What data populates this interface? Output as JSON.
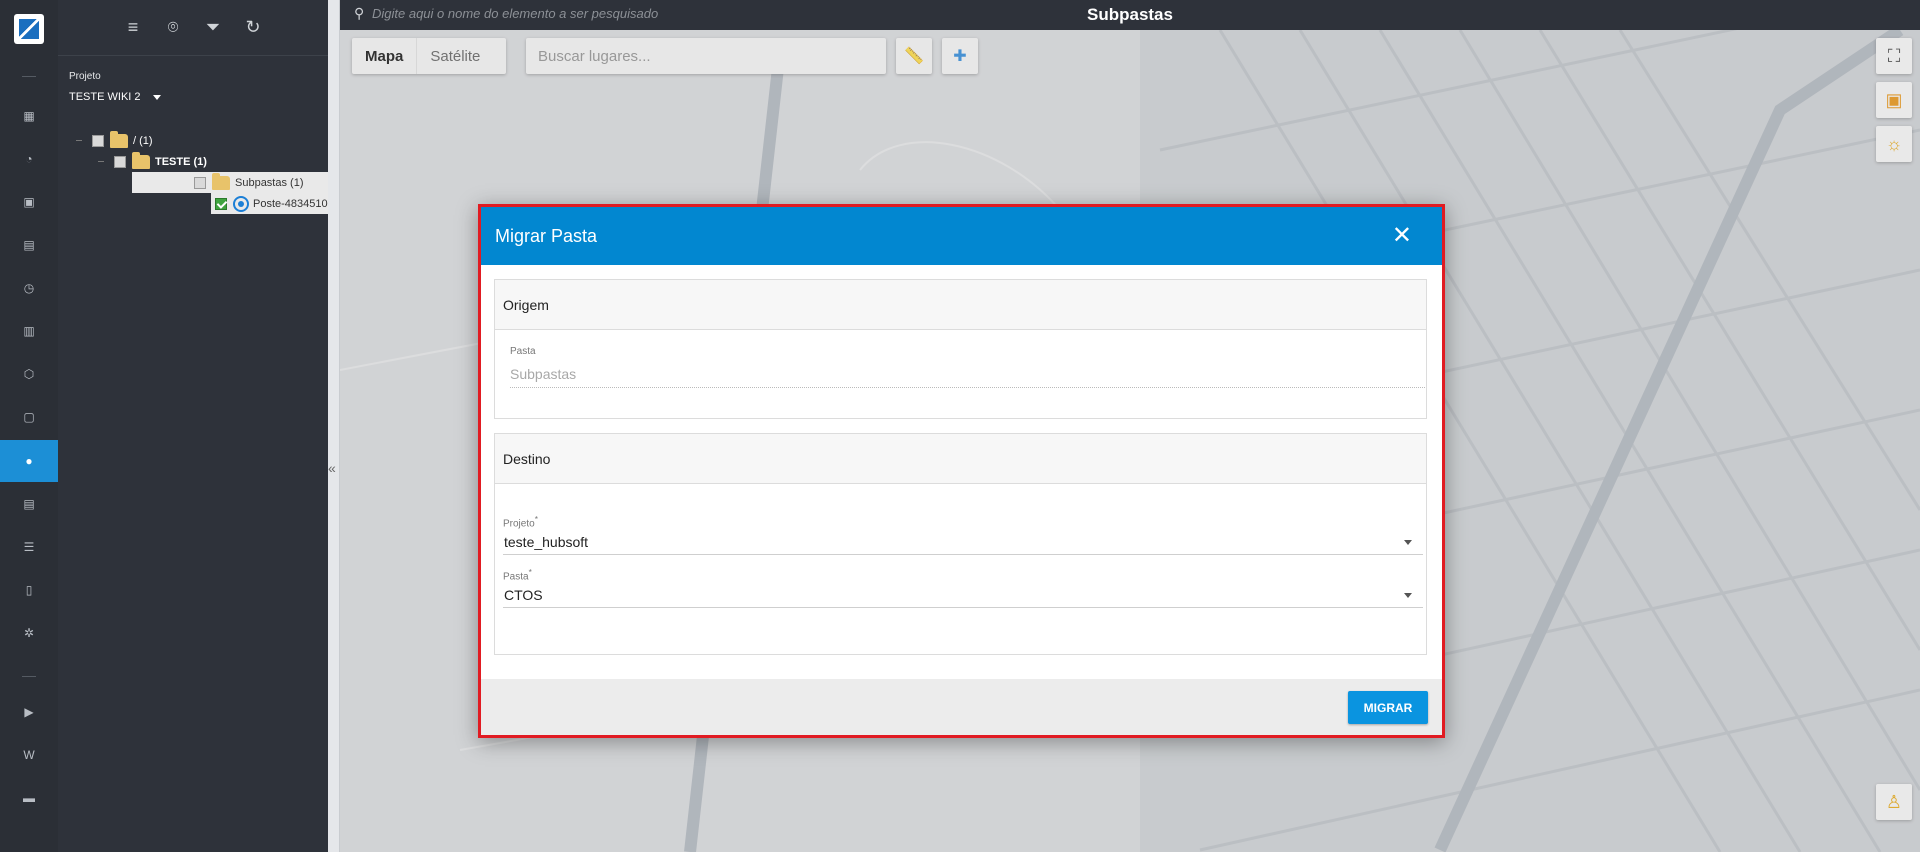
{
  "topbar": {
    "search_placeholder": "Digite aqui o nome do elemento a ser pesquisado",
    "title": "Subpastas"
  },
  "panel": {
    "project_label": "Projeto",
    "project_value": "TESTE WIKI 2",
    "tree": [
      {
        "label": "/ (1)"
      },
      {
        "label": "TESTE (1)"
      },
      {
        "label": "Subpastas (1)"
      },
      {
        "label": "Poste-4834510"
      }
    ]
  },
  "map": {
    "type_map": "Mapa",
    "type_satellite": "Satélite",
    "places_placeholder": "Buscar lugares..."
  },
  "modal": {
    "title": "Migrar Pasta",
    "origem": {
      "heading": "Origem",
      "pasta_label": "Pasta",
      "pasta_value": "Subpastas"
    },
    "destino": {
      "heading": "Destino",
      "projeto_label": "Projeto",
      "projeto_value": "teste_hubsoft",
      "pasta_label": "Pasta",
      "pasta_value": "CTOS",
      "required_mark": "*"
    },
    "submit_label": "MIGRAR"
  },
  "colors": {
    "header_blue": "#0287d0",
    "highlight_border": "#e11b22",
    "button_blue": "#0a94e0"
  }
}
